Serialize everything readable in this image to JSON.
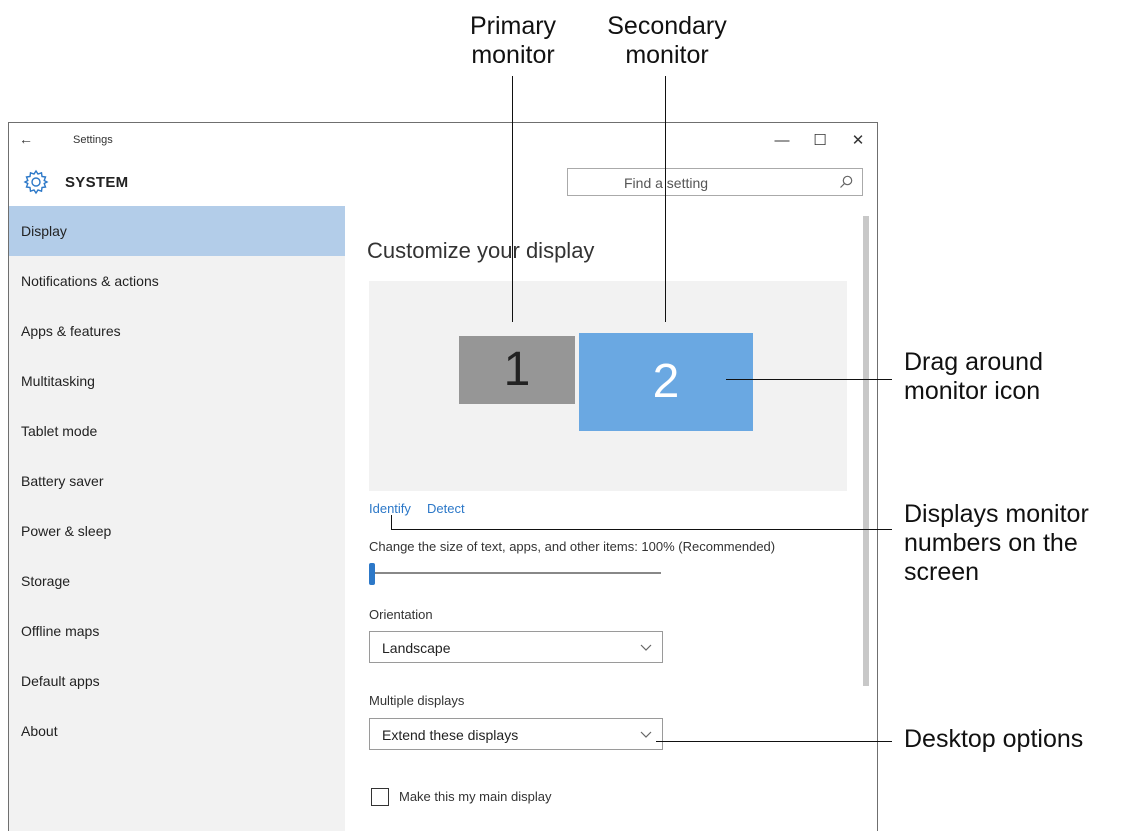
{
  "callouts": {
    "primary_monitor": "Primary\nmonitor",
    "secondary_monitor": "Secondary\nmonitor",
    "drag_around": "Drag around\nmonitor icon",
    "displays_numbers": "Displays monitor\nnumbers on the\nscreen",
    "desktop_options": "Desktop options"
  },
  "window": {
    "back_arrow": "←",
    "title": "Settings",
    "minimize": "—",
    "maximize": "☐",
    "close": "✕"
  },
  "header": {
    "section_title": "SYSTEM",
    "search_placeholder": "Find a setting"
  },
  "sidebar": {
    "items": [
      {
        "label": "Display",
        "active": true
      },
      {
        "label": "Notifications & actions"
      },
      {
        "label": "Apps & features"
      },
      {
        "label": "Multitasking"
      },
      {
        "label": "Tablet mode"
      },
      {
        "label": "Battery saver"
      },
      {
        "label": "Power & sleep"
      },
      {
        "label": "Storage"
      },
      {
        "label": "Offline maps"
      },
      {
        "label": "Default apps"
      },
      {
        "label": "About"
      }
    ]
  },
  "main": {
    "title": "Customize your display",
    "monitors": {
      "primary": "1",
      "secondary": "2"
    },
    "identify_link": "Identify",
    "detect_link": "Detect",
    "scale_label": "Change the size of text, apps, and other items: 100% (Recommended)",
    "scale_slider_value": 0,
    "orientation_label": "Orientation",
    "orientation_value": "Landscape",
    "multiple_displays_label": "Multiple displays",
    "multiple_displays_value": "Extend these displays",
    "main_display_checkbox_label": "Make this my main display",
    "main_display_checked": false
  },
  "colors": {
    "accent": "#2c78c8",
    "sidebar_active": "#b3cde9",
    "secondary_monitor": "#6aa8e2",
    "primary_monitor": "#969696"
  }
}
